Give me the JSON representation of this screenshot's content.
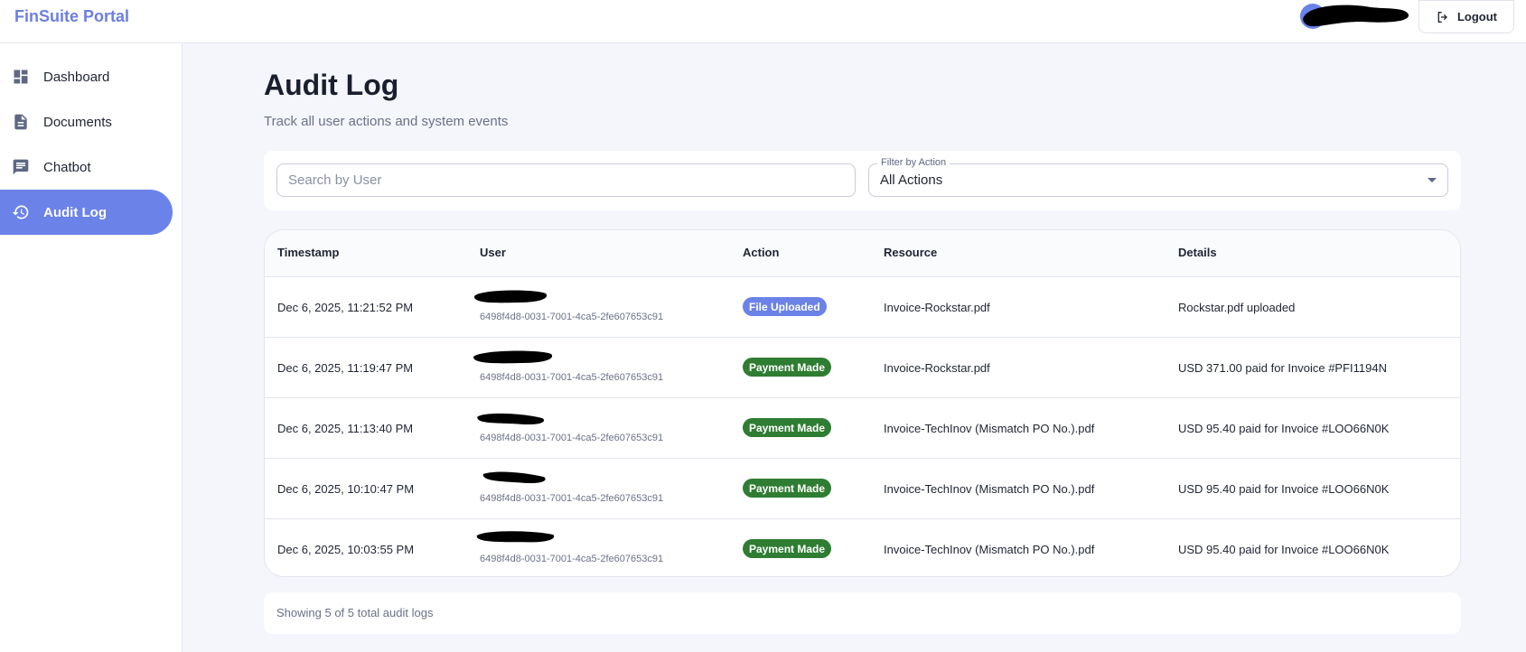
{
  "app": {
    "title": "FinSuite Portal"
  },
  "header": {
    "logout_label": "Logout"
  },
  "sidebar": {
    "items": [
      {
        "label": "Dashboard",
        "icon": "dashboard-icon"
      },
      {
        "label": "Documents",
        "icon": "document-icon"
      },
      {
        "label": "Chatbot",
        "icon": "chat-icon"
      },
      {
        "label": "Audit Log",
        "icon": "history-icon",
        "active": true
      }
    ]
  },
  "page": {
    "title": "Audit Log",
    "subtitle": "Track all user actions and system events"
  },
  "filters": {
    "search_placeholder": "Search by User",
    "search_value": "",
    "action_label": "Filter by Action",
    "action_value": "All Actions"
  },
  "table": {
    "columns": [
      "Timestamp",
      "User",
      "Action",
      "Resource",
      "Details"
    ],
    "rows": [
      {
        "timestamp": "Dec 6, 2025, 11:21:52 PM",
        "user_id": "6498f4d8-0031-7001-4ca5-2fe607653c91",
        "action": "File Uploaded",
        "resource": "Invoice-Rockstar.pdf",
        "details": "Rockstar.pdf uploaded"
      },
      {
        "timestamp": "Dec 6, 2025, 11:19:47 PM",
        "user_id": "6498f4d8-0031-7001-4ca5-2fe607653c91",
        "action": "Payment Made",
        "resource": "Invoice-Rockstar.pdf",
        "details": "USD 371.00 paid for Invoice #PFI1194N"
      },
      {
        "timestamp": "Dec 6, 2025, 11:13:40 PM",
        "user_id": "6498f4d8-0031-7001-4ca5-2fe607653c91",
        "action": "Payment Made",
        "resource": "Invoice-TechInov (Mismatch PO No.).pdf",
        "details": "USD 95.40 paid for Invoice #LOO66N0K"
      },
      {
        "timestamp": "Dec 6, 2025, 10:10:47 PM",
        "user_id": "6498f4d8-0031-7001-4ca5-2fe607653c91",
        "action": "Payment Made",
        "resource": "Invoice-TechInov (Mismatch PO No.).pdf",
        "details": "USD 95.40 paid for Invoice #LOO66N0K"
      },
      {
        "timestamp": "Dec 6, 2025, 10:03:55 PM",
        "user_id": "6498f4d8-0031-7001-4ca5-2fe607653c91",
        "action": "Payment Made",
        "resource": "Invoice-TechInov (Mismatch PO No.).pdf",
        "details": "USD 95.40 paid for Invoice #LOO66N0K"
      }
    ]
  },
  "footer": {
    "summary": "Showing 5 of 5 total audit logs"
  },
  "colors": {
    "accent": "#6b82e8",
    "success": "#2e7d32",
    "redaction": "#000000"
  }
}
